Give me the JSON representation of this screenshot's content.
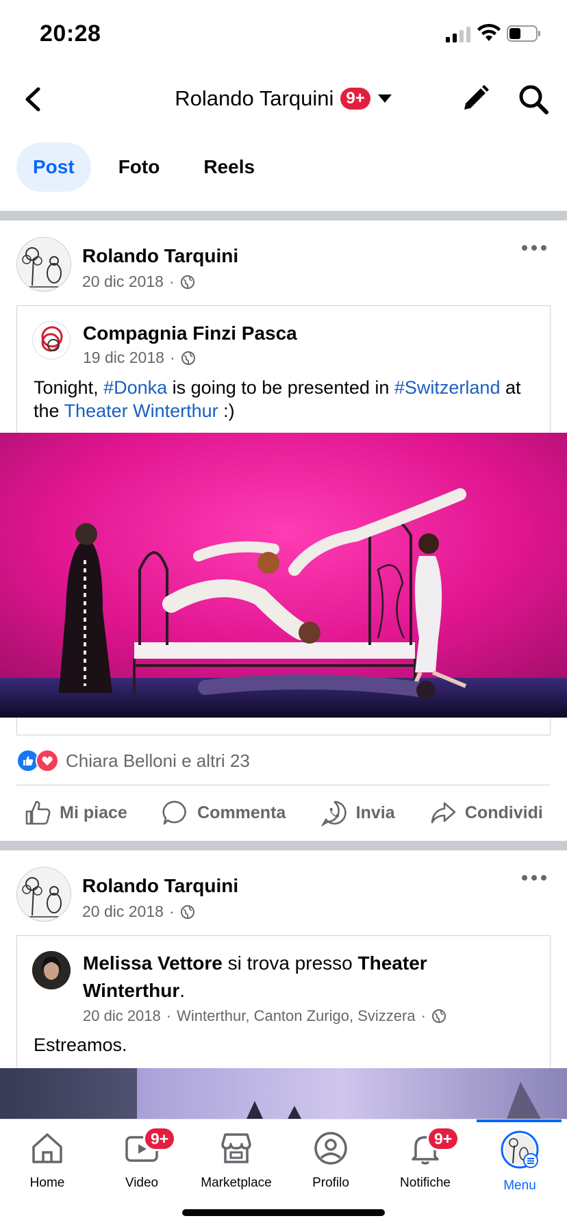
{
  "status_bar": {
    "time": "20:28"
  },
  "nav": {
    "title": "Rolando Tarquini",
    "badge": "9+"
  },
  "tabs": [
    {
      "label": "Post",
      "active": true
    },
    {
      "label": "Foto",
      "active": false
    },
    {
      "label": "Reels",
      "active": false
    }
  ],
  "posts": [
    {
      "author": "Rolando Tarquini",
      "date": "20 dic 2018",
      "shared": {
        "author": "Compagnia Finzi Pasca",
        "date": "19 dic 2018",
        "text_parts": [
          "Tonight, ",
          "#Donka",
          " is going to be presented in ",
          "#Switzerland",
          " at the ",
          "Theater Winterthur",
          " :)"
        ]
      },
      "reactions_text": "Chiara Belloni e altri 23"
    },
    {
      "author": "Rolando Tarquini",
      "date": "20 dic 2018",
      "checkin": {
        "person": "Melissa Vettore",
        "connector": " si trova presso ",
        "place": "Theater Winterthur",
        "end": ".",
        "date": "20 dic 2018",
        "location": "Winterthur, Canton Zurigo, Svizzera",
        "body": "Estreamos."
      }
    }
  ],
  "actions": {
    "like": "Mi piace",
    "comment": "Commenta",
    "send": "Invia",
    "share": "Condividi"
  },
  "bottom_nav": [
    {
      "label": "Home",
      "badge": ""
    },
    {
      "label": "Video",
      "badge": "9+"
    },
    {
      "label": "Marketplace",
      "badge": ""
    },
    {
      "label": "Profilo",
      "badge": ""
    },
    {
      "label": "Notifiche",
      "badge": "9+"
    },
    {
      "label": "Menu",
      "badge": "",
      "active": true
    }
  ],
  "colors": {
    "accent": "#0866ff",
    "badge": "#e41e3f",
    "stage_pink": "#e0158f",
    "link": "#1a5fbf"
  }
}
